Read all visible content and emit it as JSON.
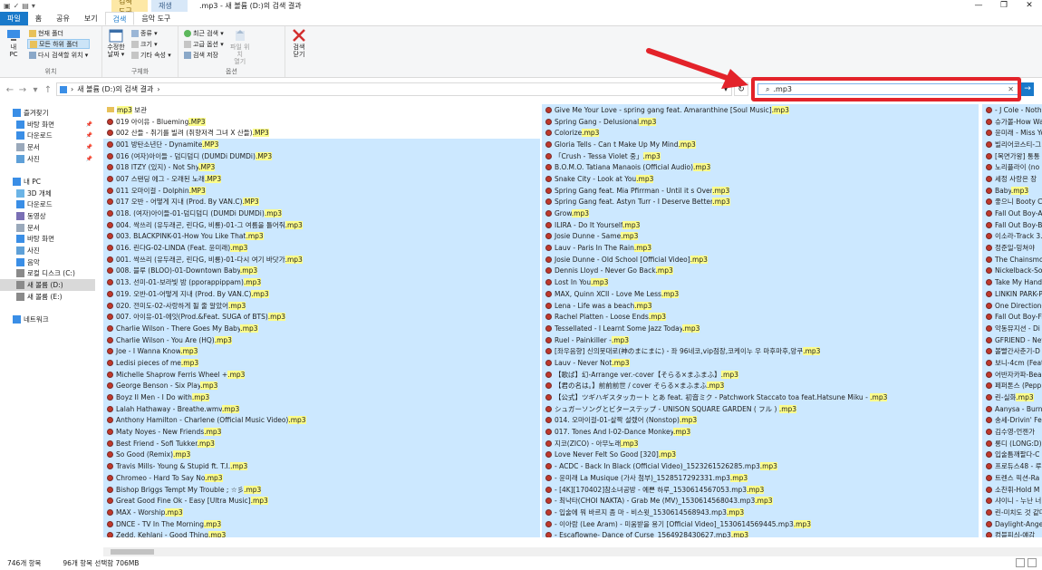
{
  "window": {
    "title": ".mp3 - 새 볼륨 (D:)의 검색 결과",
    "context_tab_search": "검색 도구",
    "context_tab_play": "재생",
    "min": "—",
    "max": "❐",
    "close": "✕",
    "help": "?"
  },
  "tabs": [
    {
      "label": "파일",
      "kind": "file"
    },
    {
      "label": "홈",
      "kind": "normal"
    },
    {
      "label": "공유",
      "kind": "normal"
    },
    {
      "label": "보기",
      "kind": "normal"
    },
    {
      "label": "검색",
      "kind": "active"
    },
    {
      "label": "음악 도구",
      "kind": "normal"
    }
  ],
  "ribbon": {
    "location": {
      "label": "위치",
      "pc": "내\nPC",
      "current_folder": "현재 폴더",
      "all_subfolders": "모든 하위 폴더",
      "search_again": "다시 검색할 위치 ▾"
    },
    "refine": {
      "label": "구체화",
      "modified": "수정한\n날짜 ▾",
      "kind": "종류 ▾",
      "size": "크기 ▾",
      "other": "기타 속성 ▾"
    },
    "options": {
      "label": "옵션",
      "recent": "최근 검색 ▾",
      "advanced": "고급 옵션 ▾",
      "save": "검색 저장",
      "open_location": "파일 위치\n열기",
      "close_search": "검색\n닫기"
    }
  },
  "address": {
    "path": "새 볼륨 (D:)의 검색 결과",
    "search_value": ".mp3",
    "refresh": "↻",
    "go": "→"
  },
  "nav": [
    {
      "label": "즐겨찾기",
      "icon": "star-icon",
      "indent": 0,
      "pin": false
    },
    {
      "label": "바탕 화면",
      "icon": "desktop-icon",
      "indent": 1,
      "pin": true
    },
    {
      "label": "다운로드",
      "icon": "download-icon",
      "indent": 1,
      "pin": true
    },
    {
      "label": "문서",
      "icon": "document-icon",
      "indent": 1,
      "pin": true
    },
    {
      "label": "사진",
      "icon": "picture-icon",
      "indent": 1,
      "pin": true
    },
    {
      "label": "",
      "icon": "",
      "indent": 0,
      "pin": false
    },
    {
      "label": "내 PC",
      "icon": "pc-icon",
      "indent": 0,
      "pin": false
    },
    {
      "label": "3D 개체",
      "icon": "3d-icon",
      "indent": 1,
      "pin": false
    },
    {
      "label": "다운로드",
      "icon": "download-icon",
      "indent": 1,
      "pin": false
    },
    {
      "label": "동영상",
      "icon": "video-icon",
      "indent": 1,
      "pin": false
    },
    {
      "label": "문서",
      "icon": "document-icon",
      "indent": 1,
      "pin": false
    },
    {
      "label": "바탕 화면",
      "icon": "desktop-icon",
      "indent": 1,
      "pin": false
    },
    {
      "label": "사진",
      "icon": "picture-icon",
      "indent": 1,
      "pin": false
    },
    {
      "label": "음악",
      "icon": "music-icon",
      "indent": 1,
      "pin": false
    },
    {
      "label": "로컬 디스크 (C:)",
      "icon": "drive-icon",
      "indent": 1,
      "pin": false
    },
    {
      "label": "새 볼륨 (D:)",
      "icon": "drive-icon",
      "indent": 1,
      "pin": false,
      "selected": true
    },
    {
      "label": "새 볼륨 (E:)",
      "icon": "drive-icon",
      "indent": 1,
      "pin": false
    },
    {
      "label": "",
      "icon": "",
      "indent": 0,
      "pin": false
    },
    {
      "label": "네트워크",
      "icon": "network-icon",
      "indent": 0,
      "pin": false
    }
  ],
  "columns": [
    [
      {
        "name": "mp3 보관",
        "folder": true,
        "hl_start": 0,
        "hl_text": "mp3",
        "sel": false
      },
      {
        "name": "019 아이유 - Blueming.MP3",
        "sel": false
      },
      {
        "name": "002 산들 - 취기를 빌려 (취향저격 그녀 X 산들).MP3",
        "sel": false
      },
      {
        "name": "001 방탄소년단 - Dynamite.MP3",
        "sel": true
      },
      {
        "name": "016 (여자)아이들 - 덤디덤디 (DUMDi DUMDi).MP3",
        "sel": true
      },
      {
        "name": "018 ITZY (있지) - Not Shy.MP3",
        "sel": true
      },
      {
        "name": "007 스탠딩 에그 - 오래된 노래.MP3",
        "sel": true
      },
      {
        "name": "011 오마이걸 - Dolphin.MP3",
        "sel": true
      },
      {
        "name": "017 오반 - 어떻게 지내 (Prod. By VAN.C).MP3",
        "sel": true
      },
      {
        "name": "018. (여자)아이들-01-덤디덤디 (DUMDi DUMDi).mp3",
        "sel": true
      },
      {
        "name": "004. 싹쓰리 (유두래곤, 린다G, 비룡)-01-그 여름을 틀어줘.mp3",
        "sel": true
      },
      {
        "name": "003. BLACKPINK-01-How You Like That.mp3",
        "sel": true
      },
      {
        "name": "016. 린다G-02-LINDA (Feat. 윤미래).mp3",
        "sel": true
      },
      {
        "name": "001. 싹쓰리 (유두래곤, 린다G, 비룡)-01-다시 여기 바닷가.mp3",
        "sel": true
      },
      {
        "name": "008. 블루 (BLOO)-01-Downtown Baby.mp3",
        "sel": true
      },
      {
        "name": "013. 선미-01-보라빛 밤 (pporappippam).mp3",
        "sel": true
      },
      {
        "name": "019. 오반-01-어떻게 지내 (Prod. By VAN.C).mp3",
        "sel": true
      },
      {
        "name": "020. 전미도-02-사랑하게 될 줄 알았어.mp3",
        "sel": true
      },
      {
        "name": "007. 아이유-01-에잇(Prod.&Feat. SUGA of BTS).mp3",
        "sel": true
      },
      {
        "name": "Charlie Wilson - There Goes My Baby.mp3",
        "sel": true
      },
      {
        "name": "Charlie Wilson - You Are (HQ).mp3",
        "sel": true
      },
      {
        "name": "Joe - I Wanna Know.mp3",
        "sel": true
      },
      {
        "name": "Ledisi pieces of me.mp3",
        "sel": true
      },
      {
        "name": "Michelle Shaprow Ferris Wheel +.mp3",
        "sel": true
      },
      {
        "name": "George Benson - Six Play.mp3",
        "sel": true
      },
      {
        "name": "Boyz II Men - I Do with.mp3",
        "sel": true
      },
      {
        "name": "Lalah Hathaway - Breathe.wmv.mp3",
        "sel": true
      },
      {
        "name": "Anthony Hamilton - Charlene (Official Music Video).mp3",
        "sel": true
      },
      {
        "name": "Maty Noyes - New Friends.mp3",
        "sel": true
      },
      {
        "name": "Best Friend - Sofi Tukker.mp3",
        "sel": true
      },
      {
        "name": "So Good (Remix).mp3",
        "sel": true
      },
      {
        "name": "Travis Mills- Young & Stupid ft. T.I..mp3",
        "sel": true
      },
      {
        "name": "Chromeo - Hard To Say No.mp3",
        "sel": true
      },
      {
        "name": "Bishop Briggs Tempt My Trouble ; ☆彡.mp3",
        "sel": true
      },
      {
        "name": "Great Good Fine Ok - Easy [Ultra Music].mp3",
        "sel": true
      },
      {
        "name": "MAX - Worship.mp3",
        "sel": true
      },
      {
        "name": "DNCE - TV In The Morning.mp3",
        "sel": true
      },
      {
        "name": "Zedd, Kehlani - Good Thing.mp3",
        "sel": true
      }
    ],
    [
      {
        "name": "Give Me Your Love - spring gang feat. Amaranthine [Soul Music].mp3",
        "sel": true
      },
      {
        "name": "Spring Gang - Delusional.mp3",
        "sel": true
      },
      {
        "name": "Colorize.mp3",
        "sel": true
      },
      {
        "name": "Gloria Tells - Can t Make Up My Mind.mp3",
        "sel": true
      },
      {
        "name": "「Crush - Tessa Violet 중」.mp3",
        "sel": true
      },
      {
        "name": "B.O.M.O. Tatiana Manaois (Official Audio).mp3",
        "sel": true
      },
      {
        "name": "Snake City - Look at You.mp3",
        "sel": true
      },
      {
        "name": "Spring Gang feat. Mia Pfirrman - Until it s Over.mp3",
        "sel": true
      },
      {
        "name": "Spring Gang feat. Astyn Turr - I Deserve Better.mp3",
        "sel": true
      },
      {
        "name": "Grow.mp3",
        "sel": true
      },
      {
        "name": "ILIRA - Do It Yourself.mp3",
        "sel": true
      },
      {
        "name": "Josie Dunne - Same.mp3",
        "sel": true
      },
      {
        "name": "Lauv - Paris In The Rain.mp3",
        "sel": true
      },
      {
        "name": "Josie Dunne - Old School [Official Video].mp3",
        "sel": true
      },
      {
        "name": "Dennis Lloyd - Never Go Back.mp3",
        "sel": true
      },
      {
        "name": "Lost In You.mp3",
        "sel": true
      },
      {
        "name": "MAX, Quinn XCII - Love Me Less.mp3",
        "sel": true
      },
      {
        "name": "Lena - Life was a beach.mp3",
        "sel": true
      },
      {
        "name": "Rachel Platten - Loose Ends.mp3",
        "sel": true
      },
      {
        "name": "Tessellated - I Learnt Some Jazz Today.mp3",
        "sel": true
      },
      {
        "name": "Ruel - Painkiller -.mp3",
        "sel": true
      },
      {
        "name": "[좌우음향] 신의못대로(神のまにまに) - 좌 96네코,vip점장,코케이누 우 마후마후,앙쿠.mp3",
        "sel": true
      },
      {
        "name": "Lauv - Never Not.mp3",
        "sel": true
      },
      {
        "name": "【歌ば】幻-Arrange ver.-cover【そらる×まふまふ】.mp3",
        "sel": true
      },
      {
        "name": "【君の名は。】前前前世 / cover そらる×まふまふ.mp3",
        "sel": true
      },
      {
        "name": "【公式】ツギハギスタッカート とあ feat. 初音ミク - Patchwork Staccato toa feat.Hatsune Miku - .mp3",
        "sel": true
      },
      {
        "name": "シュガーソングとビターステップ - UNISON SQUARE GARDEN ( フル ) .mp3",
        "sel": true
      },
      {
        "name": "014. 오마이걸-01-살짝 설렜어 (Nonstop).mp3",
        "sel": true
      },
      {
        "name": "017. Tones And I-02-Dance Monkey.mp3",
        "sel": true
      },
      {
        "name": "지코(ZICO) - 아무노래.mp3",
        "sel": true
      },
      {
        "name": "Love Never Felt So Good [320].mp3",
        "sel": true
      },
      {
        "name": "- ACDC - Back In Black (Official Video)_1523261526285.mp3.mp3",
        "sel": true
      },
      {
        "name": "- 윤미래 La Musique (가사 첨부)_1528517292331.mp3.mp3",
        "sel": true
      },
      {
        "name": "- [4K][170402]참소녀공방 - 예쁜 하루_1530614567053.mp3.mp3",
        "sel": true
      },
      {
        "name": "- 최낙타(CHOI NAKTA) - Grab Me (MV)_1530614568043.mp3.mp3",
        "sel": true
      },
      {
        "name": "- 입술에 뭐 바르지 좀 마 - 비스윗_1530614568943.mp3.mp3",
        "sel": true
      },
      {
        "name": "- 이아람 (Lee Aram) - 미움받을 용기 [Official Video]_1530614569445.mp3.mp3",
        "sel": true
      },
      {
        "name": "- Escaflowne- Dance of Curse_1564928430627.mp3.mp3",
        "sel": true
      }
    ],
    [
      {
        "name": "- J Cole - Nothing",
        "sel": true
      },
      {
        "name": "슈가볼-How Wa",
        "sel": true
      },
      {
        "name": "윤미래 - Miss Yo",
        "sel": true
      },
      {
        "name": "빌리어코스티-그",
        "sel": true
      },
      {
        "name": "[복면가왕] 통통",
        "sel": true
      },
      {
        "name": "노리플라이 (no",
        "sel": true
      },
      {
        "name": "세정 사랑은 장",
        "sel": true
      },
      {
        "name": "Baby.mp3",
        "sel": true
      },
      {
        "name": "좋으니 Booty Ca",
        "sel": true
      },
      {
        "name": "Fall Out Boy-Ar",
        "sel": true
      },
      {
        "name": "Fall Out Boy-Ba",
        "sel": true
      },
      {
        "name": "이소라-Track 3.",
        "sel": true
      },
      {
        "name": "정준일-밍쳐야 ",
        "sel": true
      },
      {
        "name": "The Chainsmok",
        "sel": true
      },
      {
        "name": "Nickelback-Som",
        "sel": true
      },
      {
        "name": "Take My Hand.m",
        "sel": true
      },
      {
        "name": "LINKIN PARK-Pa",
        "sel": true
      },
      {
        "name": "One Direction-F",
        "sel": true
      },
      {
        "name": "Fall Out Boy-Fir",
        "sel": true
      },
      {
        "name": "악동뮤지션 - Di",
        "sel": true
      },
      {
        "name": "GFRIEND - Neve",
        "sel": true
      },
      {
        "name": "볼빨간사춘기-D",
        "sel": true
      },
      {
        "name": "보니-4cm (Feat",
        "sel": true
      },
      {
        "name": "어반자카파-Bea",
        "sel": true
      },
      {
        "name": "페퍼톤스 (Pepp",
        "sel": true
      },
      {
        "name": "린-실화.mp3",
        "sel": true
      },
      {
        "name": "Aanysa - Burn B",
        "sel": true
      },
      {
        "name": "송세-Drivin' Fe",
        "sel": true
      },
      {
        "name": "김수영-언젠가 ",
        "sel": true
      },
      {
        "name": "롱디 (LONG:D)-",
        "sel": true
      },
      {
        "name": "입술틈깨팔다-C",
        "sel": true
      },
      {
        "name": "프로듀스48 - 루",
        "sel": true
      },
      {
        "name": "트렌스 픽션-Ra",
        "sel": true
      },
      {
        "name": "소찬휘-Hold M",
        "sel": true
      },
      {
        "name": "샤이니 - 누난 너",
        "sel": true
      },
      {
        "name": "린-미치도 것 같다",
        "sel": true
      },
      {
        "name": "Daylight-Angel",
        "sel": true
      },
      {
        "name": "컴블피싀-얘감 ",
        "sel": true
      }
    ]
  ],
  "status": {
    "count": "746개 항목",
    "selected": "96개 항목 선택함 706MB"
  },
  "colors": {
    "accent": "#1979ca",
    "highlight_frame": "#e3232a",
    "selection": "#cce8ff",
    "match": "#fcfc8a"
  }
}
